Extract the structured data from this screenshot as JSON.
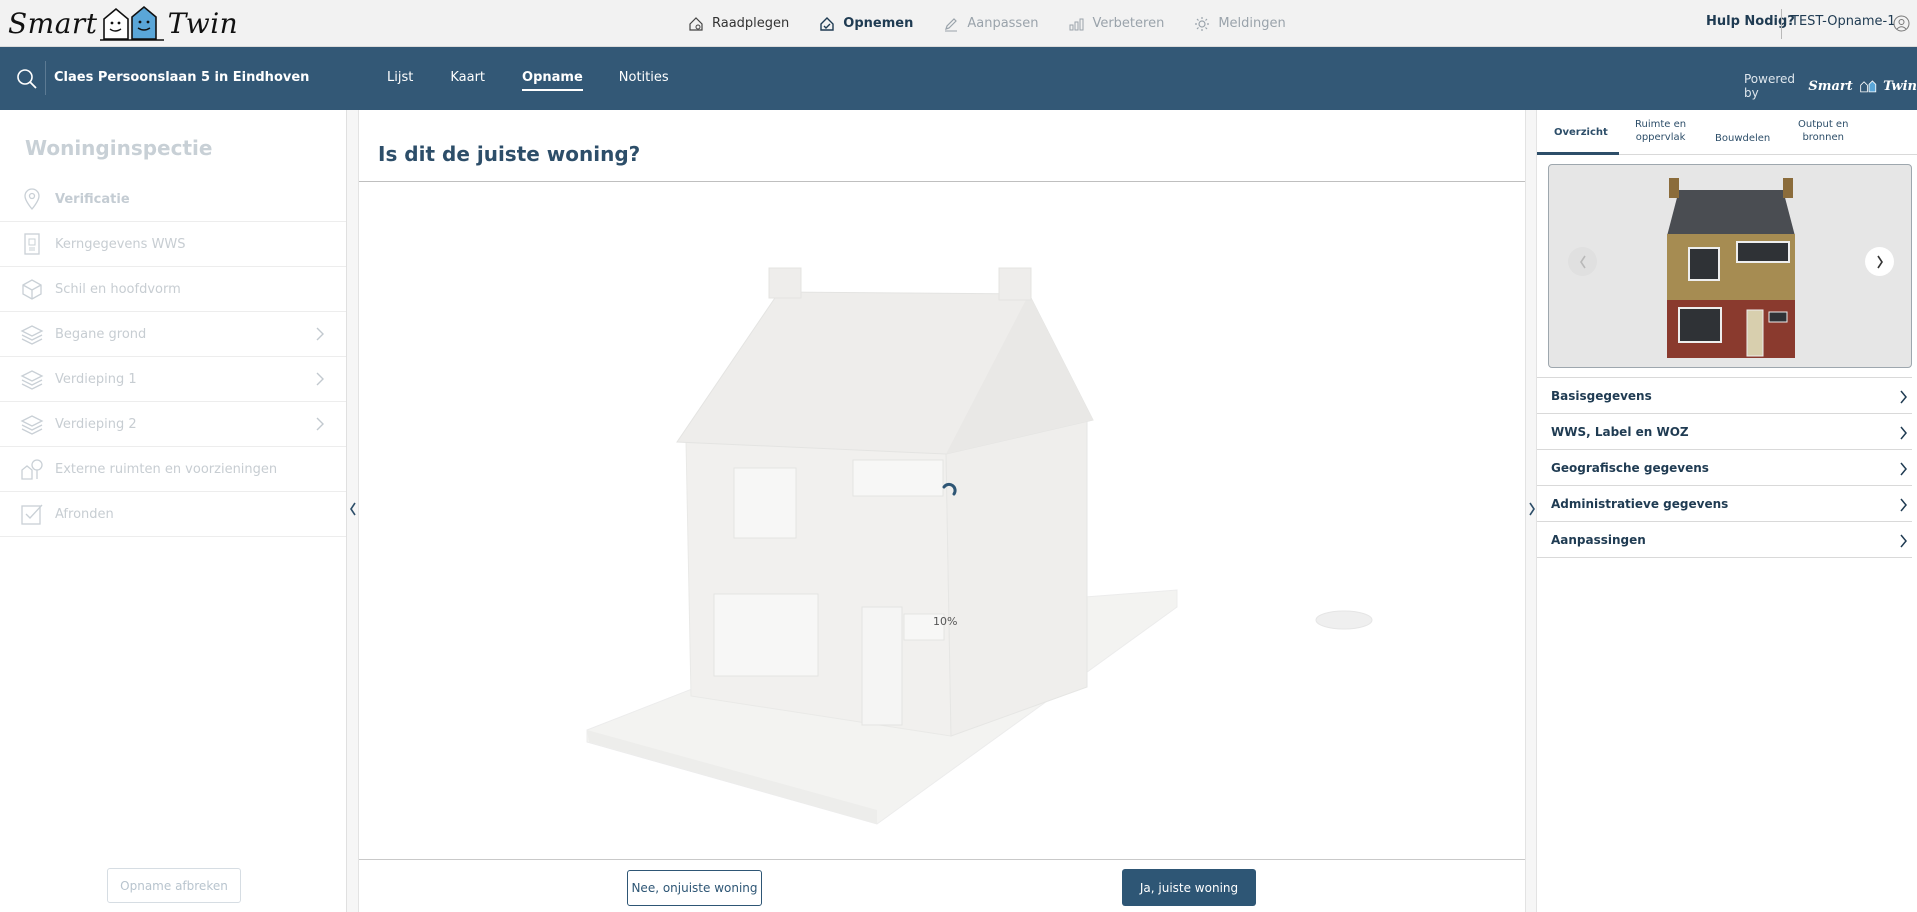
{
  "app": {
    "logo_left": "Smart",
    "logo_right": "Twin"
  },
  "topnav": {
    "items": [
      {
        "label": "Raadplegen",
        "state": "normal"
      },
      {
        "label": "Opnemen",
        "state": "active"
      },
      {
        "label": "Aanpassen",
        "state": "disabled"
      },
      {
        "label": "Verbeteren",
        "state": "disabled"
      },
      {
        "label": "Meldingen",
        "state": "disabled"
      }
    ],
    "help": "Hulp Nodig?",
    "user": "TEST-Opname-1"
  },
  "bluebar": {
    "address": "Claes Persoonslaan 5 in Eindhoven",
    "tabs": [
      "Lijst",
      "Kaart",
      "Opname",
      "Notities"
    ],
    "active_tab": "Opname",
    "powered_by": "Powered by",
    "powered_brand": "Smart",
    "powered_brand_2": "Twin"
  },
  "sidebar": {
    "title": "Woninginspectie",
    "items": [
      {
        "label": "Verificatie",
        "icon": "location-pin-icon",
        "chevron": false
      },
      {
        "label": "Kerngegevens WWS",
        "icon": "document-icon",
        "chevron": false
      },
      {
        "label": "Schil en hoofdvorm",
        "icon": "cube-icon",
        "chevron": false
      },
      {
        "label": "Begane grond",
        "icon": "layers-icon",
        "chevron": true
      },
      {
        "label": "Verdieping 1",
        "icon": "layers-icon",
        "chevron": true
      },
      {
        "label": "Verdieping 2",
        "icon": "layers-icon",
        "chevron": true
      },
      {
        "label": "Externe ruimten en voorzieningen",
        "icon": "tree-house-icon",
        "chevron": false
      },
      {
        "label": "Afronden",
        "icon": "checkbox-icon",
        "chevron": false
      }
    ],
    "abort_label": "Opname afbreken"
  },
  "main": {
    "title": "Is dit de juiste woning?",
    "loading_percent": "10%",
    "btn_no": "Nee, onjuiste woning",
    "btn_yes": "Ja, juiste woning"
  },
  "right_panel": {
    "tabs": [
      {
        "l1": "Overzicht",
        "l2": ""
      },
      {
        "l1": "Ruimte en",
        "l2": "oppervlak"
      },
      {
        "l1": "Bouwdelen",
        "l2": ""
      },
      {
        "l1": "Output en",
        "l2": "bronnen"
      }
    ],
    "accordion": [
      "Basisgegevens",
      "WWS, Label en WOZ",
      "Geografische gegevens",
      "Administratieve gegevens",
      "Aanpassingen"
    ]
  },
  "colors": {
    "brand_blue": "#335876",
    "button_blue": "#2e5675",
    "text_dark": "#1f3b52"
  }
}
